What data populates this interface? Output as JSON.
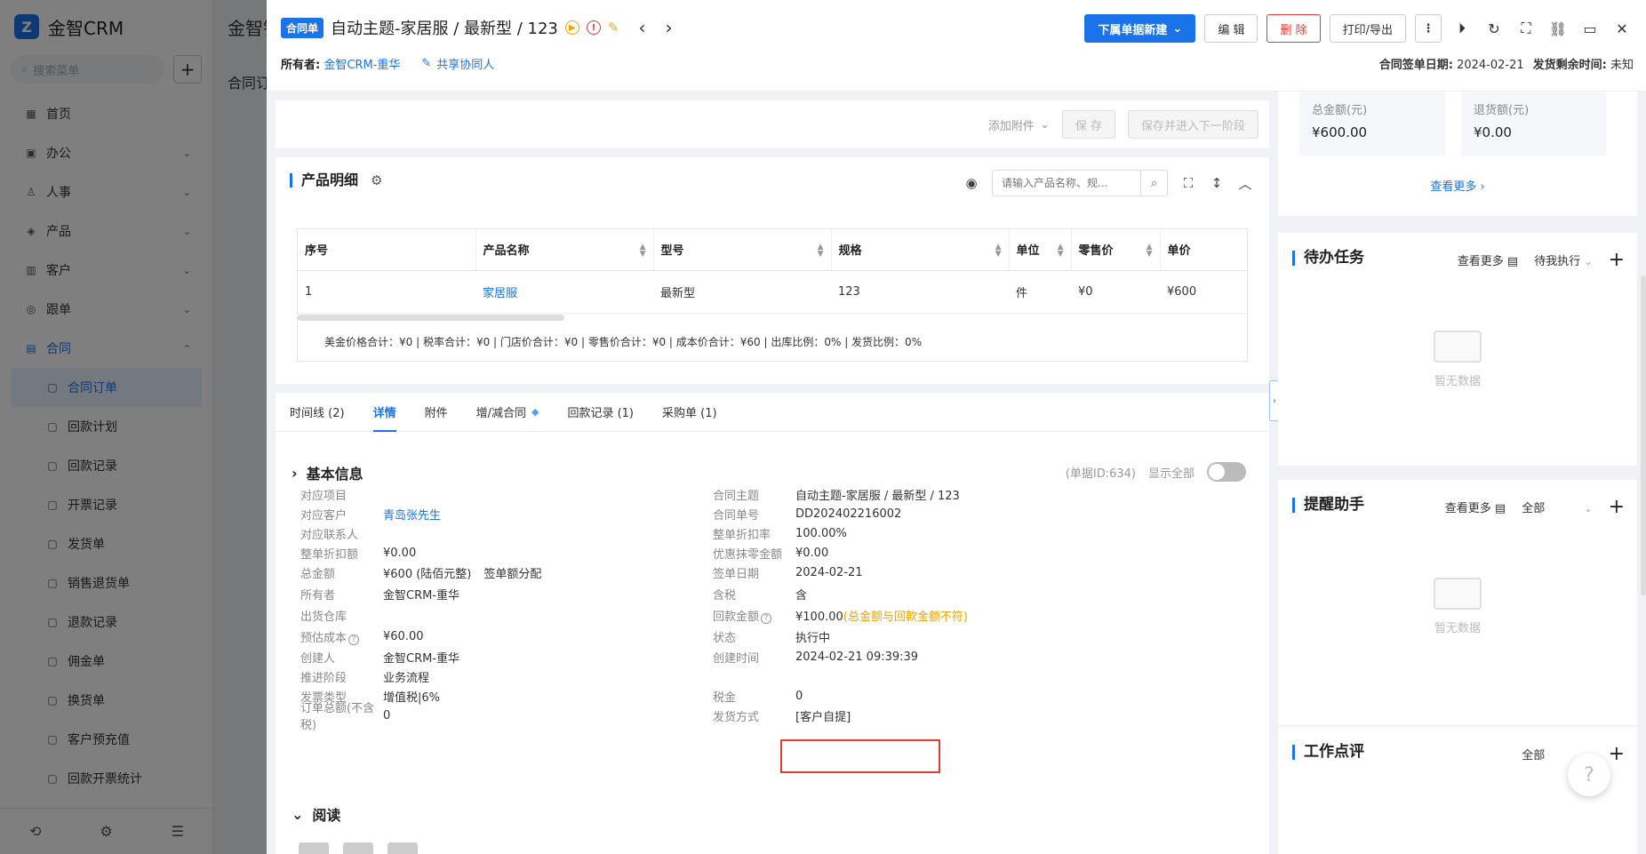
{
  "background_app": {
    "logo_text": "金智CRM",
    "search_placeholder": "搜索菜单",
    "top_title": "金智销",
    "tab_title": "合同订",
    "menu": [
      {
        "label": "首页",
        "icon": "▦",
        "caret": ""
      },
      {
        "label": "办公",
        "icon": "▣",
        "caret": "⌄"
      },
      {
        "label": "人事",
        "icon": "♙",
        "caret": "⌄"
      },
      {
        "label": "产品",
        "icon": "◈",
        "caret": "⌄"
      },
      {
        "label": "客户",
        "icon": "▥",
        "caret": "⌄"
      },
      {
        "label": "跟单",
        "icon": "◎",
        "caret": "⌄"
      },
      {
        "label": "合同",
        "icon": "▤",
        "caret": "⌃"
      }
    ],
    "submenu": [
      "合同订单",
      "回款计划",
      "回款记录",
      "开票记录",
      "发货单",
      "销售退货单",
      "退款记录",
      "佣金单",
      "换货单",
      "客户预充值",
      "回款开票统计"
    ]
  },
  "header": {
    "tag": "合同单",
    "title": "自动主题-家居服 / 最新型 / 123",
    "owner_label": "所有者:",
    "owner_value": "金智CRM-重华",
    "share_label": "共享协同人",
    "buttons": {
      "new_sub": "下属单据新建",
      "edit": "编 辑",
      "delete": "删 除",
      "print": "打印/导出",
      "more": "⋮"
    },
    "sign_date_label": "合同签单日期:",
    "sign_date_value": "2024-02-21",
    "ship_remaining_label": "发货剩余时间:",
    "ship_remaining_value": "未知"
  },
  "save_bar": {
    "attach": "添加附件",
    "save": "保 存",
    "save_next": "保存并进入下一阶段"
  },
  "products": {
    "title": "产品明细",
    "search_placeholder": "请输入产品名称、规...",
    "columns": [
      "序号",
      "产品名称",
      "型号",
      "规格",
      "单位",
      "零售价",
      "单价"
    ],
    "rows": [
      [
        "1",
        "家居服",
        "最新型",
        "123",
        "件",
        "¥0",
        "¥600"
      ]
    ],
    "summary": "美金价格合计：¥0 |   税率合计：¥0 |   门店价合计：¥0 |   零售价合计：¥0 |   成本价合计：¥60 |   出库比例：0% |   发货比例：0%"
  },
  "tabs": [
    {
      "label": "时间线 (2)",
      "active": false
    },
    {
      "label": "详情",
      "active": true
    },
    {
      "label": "附件",
      "active": false
    },
    {
      "label": "增/减合同",
      "active": false
    },
    {
      "label": "回款记录 (1)",
      "active": false
    },
    {
      "label": "采购单 (1)",
      "active": false
    }
  ],
  "basic_info": {
    "title": "基本信息",
    "doc_id": "(单据ID:634)",
    "show_all": "显示全部",
    "left_fields": [
      {
        "label": "对应项目",
        "value": ""
      },
      {
        "label": "对应客户",
        "value": "青岛张先生"
      },
      {
        "label": "对应联系人",
        "value": ""
      },
      {
        "label": "整单折扣额",
        "value": "¥0.00"
      },
      {
        "label": "总金额",
        "value": "¥600 (陆佰元整)",
        "extra": "签单额分配"
      },
      {
        "label": "所有者",
        "value": "金智CRM-重华"
      },
      {
        "label": "出货仓库",
        "value": ""
      },
      {
        "label": "预估成本",
        "value": "¥60.00"
      },
      {
        "label": "创建人",
        "value": "金智CRM-重华"
      },
      {
        "label": "推进阶段",
        "value": "业务流程"
      },
      {
        "label": "发票类型",
        "value": "增值税|6%"
      },
      {
        "label": "订单总额(不含税)",
        "value": "0"
      }
    ],
    "right_fields": [
      {
        "label": "合同主题",
        "value": "自动主题-家居服 / 最新型 / 123"
      },
      {
        "label": "合同单号",
        "value": "DD202402216002"
      },
      {
        "label": "整单折扣率",
        "value": "100.00%"
      },
      {
        "label": "优惠抹零金额",
        "value": "¥0.00"
      },
      {
        "label": "签单日期",
        "value": "2024-02-21"
      },
      {
        "label": "含税",
        "value": "含"
      },
      {
        "label": "回款金额",
        "value": "¥100.00",
        "warn": "(总金额与回款金额不符)"
      },
      {
        "label": "状态",
        "value": "执行中"
      },
      {
        "label": "创建时间",
        "value": "2024-02-21 09:39:39"
      },
      {
        "label": "",
        "value": ""
      },
      {
        "label": "税金",
        "value": "0"
      },
      {
        "label": "发货方式",
        "value": "[客户自提]"
      }
    ]
  },
  "read_section": {
    "title": "阅读"
  },
  "right_panel": {
    "money": [
      {
        "label": "总金额(元)",
        "value": "¥600.00"
      },
      {
        "label": "退货额(元)",
        "value": "¥0.00"
      }
    ],
    "see_more": "查看更多",
    "todo": {
      "title": "待办任务",
      "see_more": "查看更多",
      "filter": "待我执行",
      "empty": "暂无数据"
    },
    "remind": {
      "title": "提醒助手",
      "see_more": "查看更多",
      "filter": "全部",
      "empty": "暂无数据"
    },
    "review": {
      "title": "工作点评",
      "filter": "全部"
    }
  }
}
